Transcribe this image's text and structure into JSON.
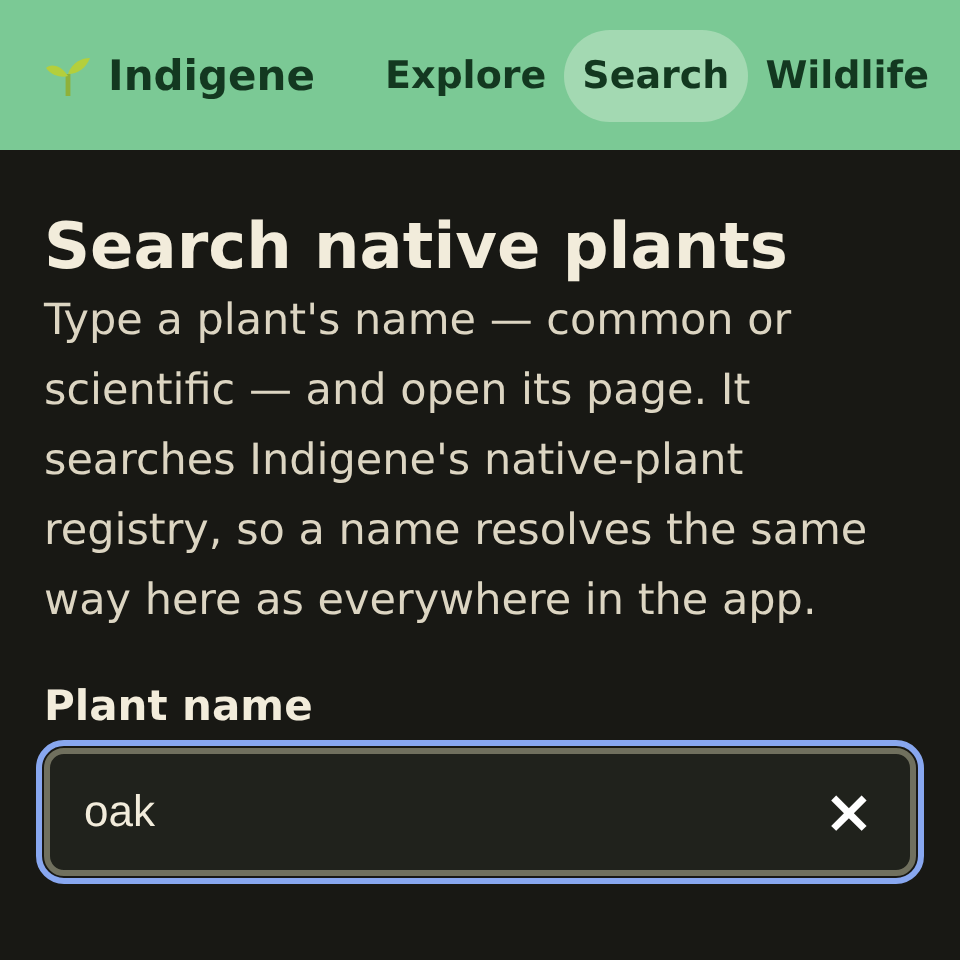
{
  "header": {
    "brand": "Indigene",
    "nav": [
      {
        "label": "Explore",
        "selected": false
      },
      {
        "label": "Search",
        "selected": true
      },
      {
        "label": "Wildlife",
        "selected": false
      }
    ]
  },
  "page": {
    "title": "Search native plants",
    "intro": "Type a plant's name — common or scientific — and open its page. It searches Indigene's native-plant registry, so a name resolves the same way here as everywhere in the app.",
    "field": {
      "label": "Plant name",
      "value": "oak",
      "focused": true,
      "clear": "×"
    }
  }
}
